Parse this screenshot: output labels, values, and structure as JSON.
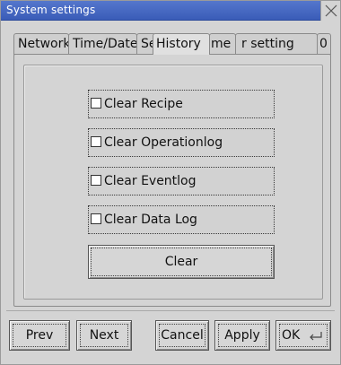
{
  "window": {
    "title": "System settings",
    "close_icon": "close-x-icon"
  },
  "tabs": [
    {
      "label": "Network",
      "active": false
    },
    {
      "label": "Time/Date",
      "active": false
    },
    {
      "label": "Se",
      "active": false
    },
    {
      "label": "History",
      "active": true
    },
    {
      "label": "me",
      "active": false
    },
    {
      "label": "r setting",
      "active": false
    },
    {
      "label": "0",
      "active": false
    }
  ],
  "history_panel": {
    "options": [
      {
        "label": "Clear Recipe",
        "checked": false
      },
      {
        "label": "Clear Operationlog",
        "checked": false
      },
      {
        "label": "Clear Eventlog",
        "checked": false
      },
      {
        "label": "Clear Data Log",
        "checked": false
      }
    ],
    "clear_button": "Clear"
  },
  "footer": {
    "prev": "Prev",
    "next": "Next",
    "cancel": "Cancel",
    "apply": "Apply",
    "ok": "OK",
    "ok_icon": "enter-key-icon"
  }
}
